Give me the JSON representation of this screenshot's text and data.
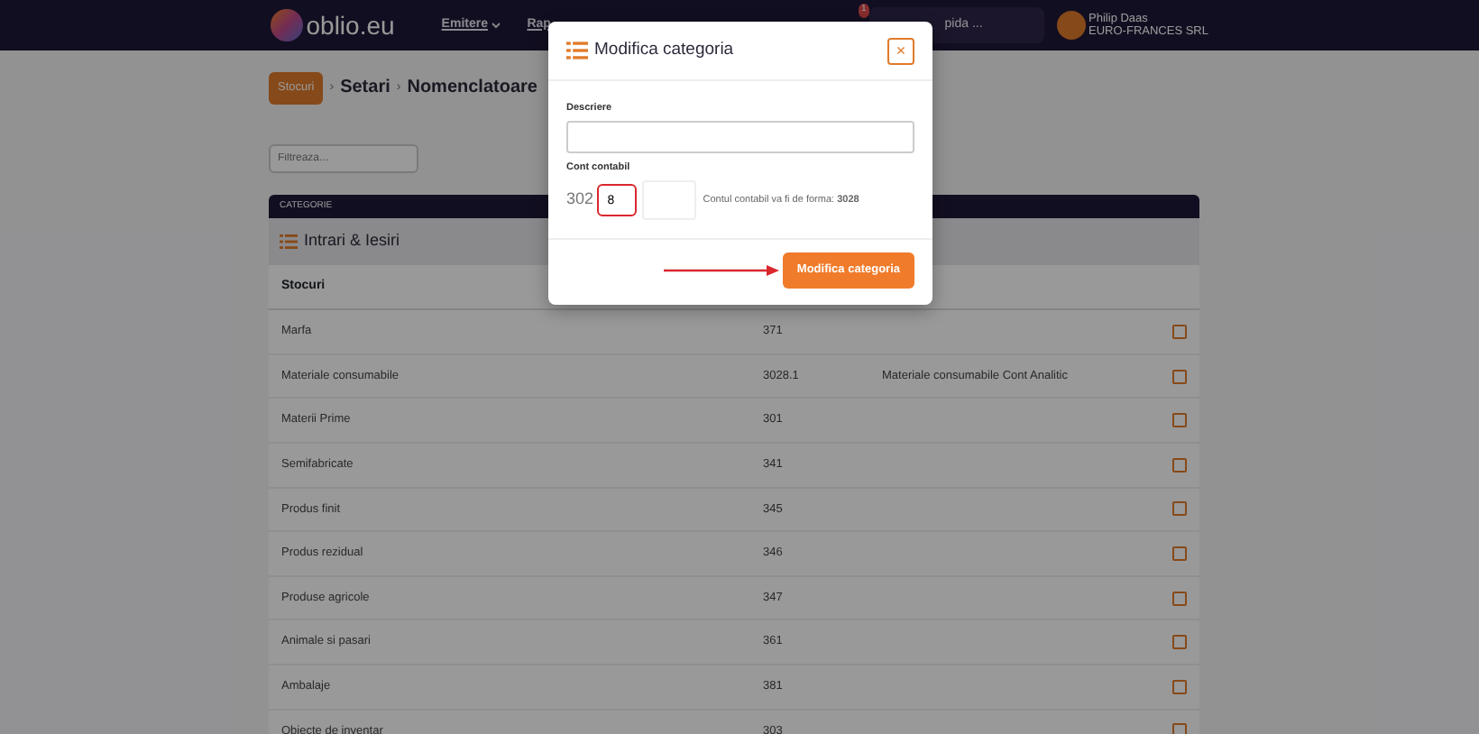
{
  "navbar": {
    "brand": "oblio.eu",
    "menu": [
      {
        "label": "Emitere",
        "dropdown": true
      },
      {
        "label": "Rap",
        "dropdown": false
      }
    ],
    "notification_count": "1",
    "search": {
      "placeholder": "pida ..."
    },
    "user": {
      "name": "Philip Daas",
      "company": "EURO-FRANCES SRL"
    }
  },
  "breadcrumb_separator": "›",
  "breadcrumb": [
    {
      "label": "Stocuri",
      "kind": "badge"
    },
    {
      "label": "Setari",
      "kind": "text"
    },
    {
      "label": "Nomenclatoare",
      "kind": "text"
    }
  ],
  "filter": {
    "placeholder": "Filtreaza..."
  },
  "section": {
    "header": "CATEGORIE",
    "title": "Intrari & Iesiri",
    "column_1": "Stocuri"
  },
  "rows": [
    {
      "name": "Marfa",
      "account": "371"
    },
    {
      "name": "Materiale consumabile",
      "account": "3028.1",
      "analytic": "Materiale consumabile Cont Analitic"
    },
    {
      "name": "Materii Prime",
      "account": "301"
    },
    {
      "name": "Semifabricate",
      "account": "341"
    },
    {
      "name": "Produs finit",
      "account": "345"
    },
    {
      "name": "Produs rezidual",
      "account": "346"
    },
    {
      "name": "Produse agricole",
      "account": "347"
    },
    {
      "name": "Animale si pasari",
      "account": "361"
    },
    {
      "name": "Ambalaje",
      "account": "381"
    },
    {
      "name": "Obiecte de inventar",
      "account": "303"
    }
  ],
  "modal": {
    "title": "Modifica categoria",
    "close": "×",
    "description_label": "Descriere",
    "account_label": "Cont contabil",
    "account_prefix": "302",
    "account_value": "8",
    "account_highlighted": true,
    "account_hint": "Contul contabil va fi de forma: **3028**",
    "submit": "Modifica categoria",
    "arrow": true
  }
}
